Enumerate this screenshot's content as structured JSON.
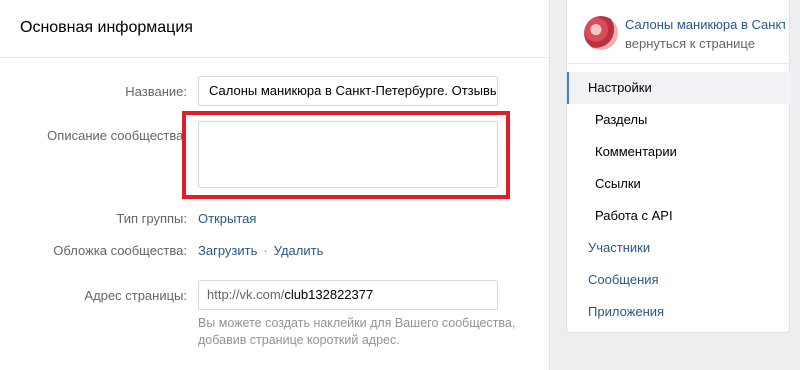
{
  "main": {
    "title": "Основная информация",
    "fields": {
      "name_label": "Название:",
      "name_value": "Салоны маникюра в Санкт-Петербурге. Отзывы",
      "description_label": "Описание сообщества:",
      "description_value": "",
      "group_type_label": "Тип группы:",
      "group_type_value": "Открытая",
      "cover_label": "Обложка сообщества:",
      "cover_upload": "Загрузить",
      "cover_separator": "·",
      "cover_delete": "Удалить",
      "address_label": "Адрес страницы:",
      "address_prefix": "http://vk.com/",
      "address_value": "club132822377",
      "hint": "Вы можете создать наклейки для Вашего сообщества, добавив странице короткий адрес."
    },
    "highlight_color": "#e01e2a"
  },
  "sidebar": {
    "group_name": "Салоны маникюра в Санкт-Петербурге. Отзывы",
    "back_link": "вернуться к странице",
    "menu": [
      {
        "label": "Настройки"
      },
      {
        "label": "Разделы"
      },
      {
        "label": "Комментарии"
      },
      {
        "label": "Ссылки"
      },
      {
        "label": "Работа с API"
      },
      {
        "label": "Участники"
      },
      {
        "label": "Сообщения"
      },
      {
        "label": "Приложения"
      }
    ]
  },
  "colors": {
    "link": "#2a5885",
    "background": "#edeef0",
    "accent": "#5181b8"
  }
}
